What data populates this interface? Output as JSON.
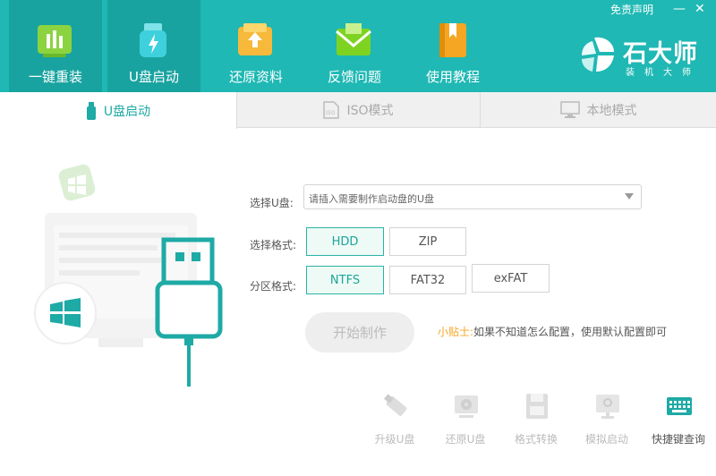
{
  "window": {
    "disclaimer": "免责声明",
    "minimize": "—",
    "close": "✕"
  },
  "nav": [
    {
      "label": "一键重装",
      "icon": "bar-chart-icon",
      "active": true
    },
    {
      "label": "U盘启动",
      "icon": "usb-icon",
      "active": true
    },
    {
      "label": "还原资料",
      "icon": "restore-box-icon",
      "active": false
    },
    {
      "label": "反馈问题",
      "icon": "envelope-icon",
      "active": false
    },
    {
      "label": "使用教程",
      "icon": "book-icon",
      "active": false
    }
  ],
  "brand": {
    "name": "石大师",
    "sub": "装机大师"
  },
  "tabs": [
    {
      "label": "U盘启动",
      "icon": "usb-icon"
    },
    {
      "label": "ISO模式",
      "icon": "iso-icon"
    },
    {
      "label": "本地模式",
      "icon": "monitor-icon"
    }
  ],
  "form": {
    "usb_label": "选择U盘:",
    "usb_placeholder": "请插入需要制作启动盘的U盘",
    "format_label": "选择格式:",
    "formats": [
      "HDD",
      "ZIP"
    ],
    "selected_format": "HDD",
    "partition_label": "分区格式:",
    "partitions": [
      "NTFS",
      "FAT32",
      "exFAT"
    ],
    "selected_partition": "NTFS"
  },
  "start_button": "开始制作",
  "tip": {
    "key": "小贴士:",
    "text": "如果不知道怎么配置，使用默认配置即可"
  },
  "tools": [
    {
      "label": "升级U盘",
      "icon": "usb-stick-icon"
    },
    {
      "label": "还原U盘",
      "icon": "restore-disk-icon"
    },
    {
      "label": "格式转换",
      "icon": "floppy-icon"
    },
    {
      "label": "模拟启动",
      "icon": "simulate-monitor-icon"
    },
    {
      "label": "快捷键查询",
      "icon": "keyboard-icon"
    }
  ],
  "colors": {
    "header": "#1fb8b4",
    "accent": "#1eaaa5",
    "tip": "#f5a623"
  }
}
